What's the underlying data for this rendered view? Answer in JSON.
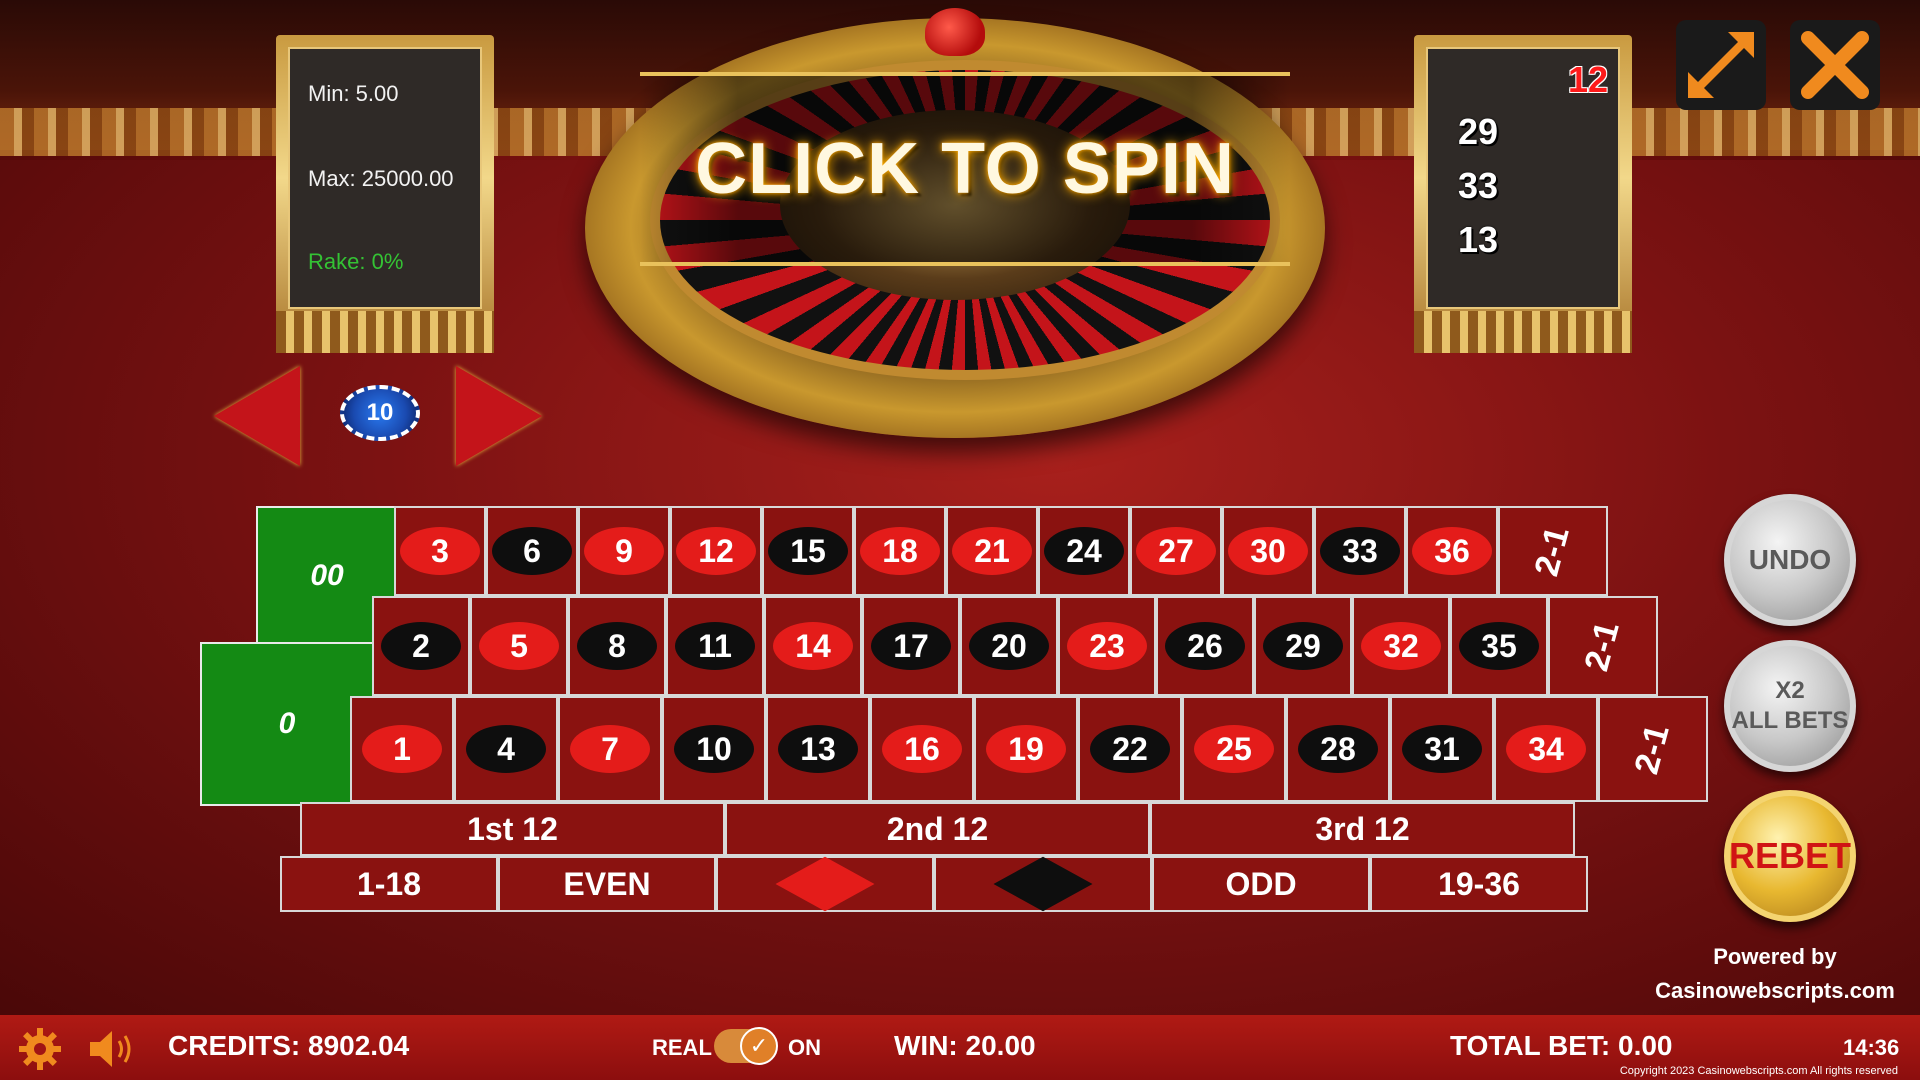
{
  "limits": {
    "min": "Min: 5.00",
    "max": "Max: 25000.00",
    "rake": "Rake: 0%"
  },
  "history": [
    {
      "number": "12",
      "color": "red"
    },
    {
      "number": "29",
      "color": "black"
    },
    {
      "number": "33",
      "color": "black"
    },
    {
      "number": "13",
      "color": "black"
    }
  ],
  "spin_label": "CLICK TO SPIN",
  "chip": {
    "value": "10"
  },
  "table": {
    "zero": "0",
    "double_zero": "00",
    "top_row": [
      [
        "3",
        "red"
      ],
      [
        "6",
        "black"
      ],
      [
        "9",
        "red"
      ],
      [
        "12",
        "red"
      ],
      [
        "15",
        "black"
      ],
      [
        "18",
        "red"
      ],
      [
        "21",
        "red"
      ],
      [
        "24",
        "black"
      ],
      [
        "27",
        "red"
      ],
      [
        "30",
        "red"
      ],
      [
        "33",
        "black"
      ],
      [
        "36",
        "red"
      ]
    ],
    "mid_row": [
      [
        "2",
        "black"
      ],
      [
        "5",
        "red"
      ],
      [
        "8",
        "black"
      ],
      [
        "11",
        "black"
      ],
      [
        "14",
        "red"
      ],
      [
        "17",
        "black"
      ],
      [
        "20",
        "black"
      ],
      [
        "23",
        "red"
      ],
      [
        "26",
        "black"
      ],
      [
        "29",
        "black"
      ],
      [
        "32",
        "red"
      ],
      [
        "35",
        "black"
      ]
    ],
    "bot_row": [
      [
        "1",
        "red"
      ],
      [
        "4",
        "black"
      ],
      [
        "7",
        "red"
      ],
      [
        "10",
        "black"
      ],
      [
        "13",
        "black"
      ],
      [
        "16",
        "red"
      ],
      [
        "19",
        "red"
      ],
      [
        "22",
        "black"
      ],
      [
        "25",
        "red"
      ],
      [
        "28",
        "black"
      ],
      [
        "31",
        "black"
      ],
      [
        "34",
        "red"
      ]
    ],
    "column_bet": "2-1",
    "dozens": {
      "first": "1st 12",
      "second": "2nd 12",
      "third": "3rd 12"
    },
    "outside": {
      "low": "1-18",
      "even": "EVEN",
      "odd": "ODD",
      "high": "19-36"
    },
    "red_color": "#e41c1a",
    "black_color": "#0e0e0e"
  },
  "buttons": {
    "undo": "UNDO",
    "x2": "X2",
    "all_bets": "ALL BETS",
    "rebet": "REBET"
  },
  "powered": {
    "line1": "Powered by",
    "line2": "Casinowebscripts.com"
  },
  "bottom": {
    "credits": "CREDITS: 8902.04",
    "real": "REAL",
    "on": "ON",
    "win": "WIN: 20.00",
    "total_bet": "TOTAL BET: 0.00",
    "time": "14:36",
    "copyright": "Copyright 2023 Casinowebscripts.com All rights reserved"
  }
}
